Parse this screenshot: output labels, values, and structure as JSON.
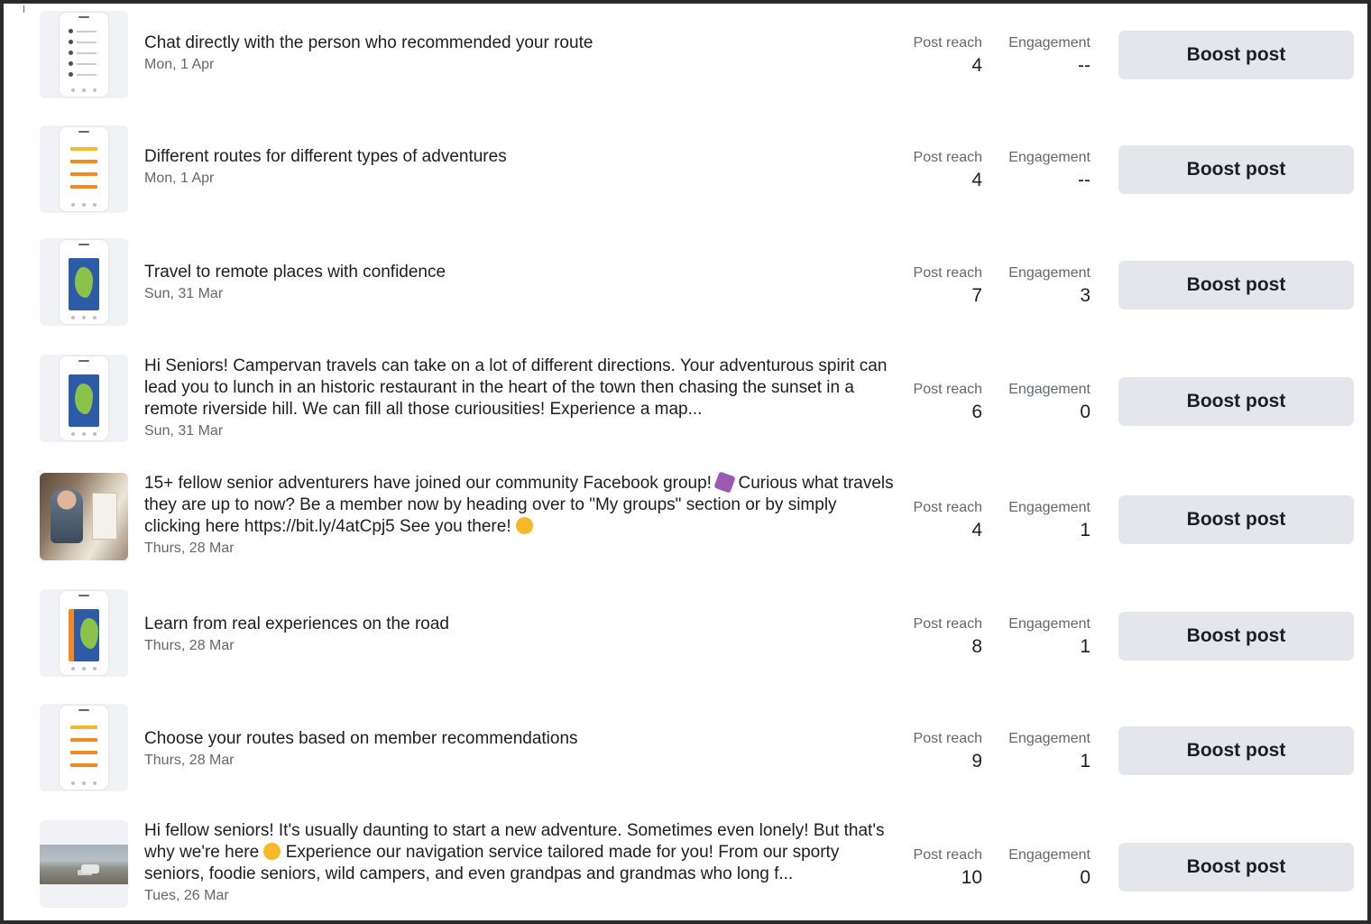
{
  "boost_label": "Boost post",
  "metric_labels": {
    "reach": "Post reach",
    "engagement": "Engagement"
  },
  "posts": [
    {
      "title": "Chat directly with the person who recommended your route",
      "date": "Mon, 1 Apr",
      "reach": "4",
      "engagement": "--",
      "thumbnail": "app-screenshot-chat-list"
    },
    {
      "title": "Different routes for different types of adventures",
      "date": "Mon, 1 Apr",
      "reach": "4",
      "engagement": "--",
      "thumbnail": "app-screenshot-route-list"
    },
    {
      "title": "Travel to remote places with confidence",
      "date": "Sun, 31 Mar",
      "reach": "7",
      "engagement": "3",
      "thumbnail": "app-screenshot-map"
    },
    {
      "title": "Hi Seniors! Campervan travels can take on a lot of different directions. Your adventurous spirit can lead you to lunch in an historic restaurant in the heart of the town then chasing the sunset in a remote riverside hill. We can fill all those curiousities! Experience a map...",
      "date": "Sun, 31 Mar",
      "reach": "6",
      "engagement": "0",
      "thumbnail": "app-screenshot-map"
    },
    {
      "title_parts": [
        "15+ fellow senior adventurers have joined our community Facebook group! ",
        " Curious what travels they are up to now? Be a member now by heading over to \"My groups\" section or by simply clicking here https://bit.ly/4atCpj5 See you there! "
      ],
      "date": "Thurs, 28 Mar",
      "reach": "4",
      "engagement": "1",
      "thumbnail": "photo-senior-couple"
    },
    {
      "title": "Learn from real experiences on the road",
      "date": "Thurs, 28 Mar",
      "reach": "8",
      "engagement": "1",
      "thumbnail": "app-screenshot-map-orange"
    },
    {
      "title": "Choose your routes based on member recommendations",
      "date": "Thurs, 28 Mar",
      "reach": "9",
      "engagement": "1",
      "thumbnail": "app-screenshot-route-list"
    },
    {
      "title_parts": [
        "Hi fellow seniors! It's usually daunting to start a new adventure. Sometimes even lonely! But that's why we're here ",
        " Experience our navigation service tailored made for you! From our sporty seniors, foodie seniors, wild campers, and even grandpas and grandmas who long f..."
      ],
      "date": "Tues, 26 Mar",
      "reach": "10",
      "engagement": "0",
      "thumbnail": "photo-campervan-beach"
    }
  ]
}
